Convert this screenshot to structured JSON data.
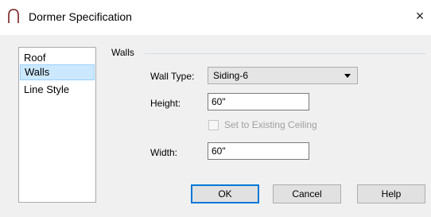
{
  "window": {
    "title": "Dormer Specification",
    "close_glyph": "×",
    "app_icon": "dormer-arc-icon"
  },
  "sidebar": {
    "items": [
      {
        "label": "Roof",
        "selected": false
      },
      {
        "label": "Walls",
        "selected": true
      },
      {
        "label": "Line Style",
        "selected": false
      }
    ],
    "selected_color": "#cce8ff"
  },
  "walls": {
    "group_label": "Walls",
    "wall_type": {
      "label": "Wall Type:",
      "value": "Siding-6"
    },
    "height": {
      "label": "Height:",
      "value": "60\""
    },
    "set_to_existing_ceiling": {
      "label": "Set to Existing Ceiling",
      "checked": false,
      "enabled": false
    },
    "width": {
      "label": "Width:",
      "value": "60\""
    }
  },
  "buttons": {
    "ok": "OK",
    "cancel": "Cancel",
    "help": "Help"
  },
  "colors": {
    "accent": "#0078d7",
    "dialog_bg": "#f0f0f0"
  }
}
